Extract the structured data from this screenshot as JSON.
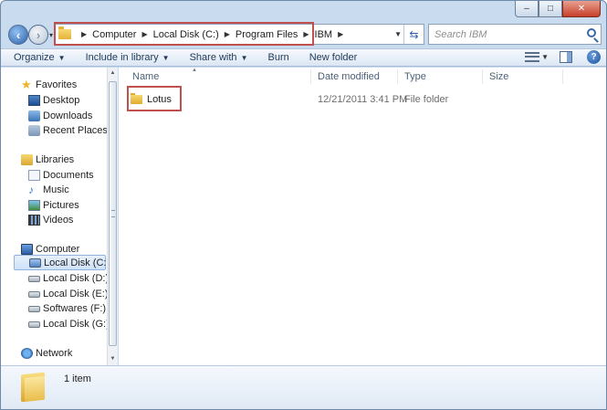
{
  "window": {
    "controls": {
      "minimize": "–",
      "maximize": "□",
      "close": "✕"
    }
  },
  "address": {
    "crumbs": [
      "Computer",
      "Local Disk (C:)",
      "Program Files",
      "IBM"
    ]
  },
  "search": {
    "placeholder": "Search IBM"
  },
  "toolbar": {
    "organize": "Organize",
    "include_in_library": "Include in library",
    "share_with": "Share with",
    "burn": "Burn",
    "new_folder": "New folder",
    "help": "?"
  },
  "nav": {
    "favorites": "Favorites",
    "desktop": "Desktop",
    "downloads": "Downloads",
    "recent_places": "Recent Places",
    "libraries": "Libraries",
    "documents": "Documents",
    "music": "Music",
    "pictures": "Pictures",
    "videos": "Videos",
    "computer": "Computer",
    "drives": [
      "Local Disk (C:)",
      "Local Disk (D:)",
      "Local Disk (E:)",
      "Softwares (F:)",
      "Local Disk (G:)"
    ],
    "network": "Network"
  },
  "columns": {
    "name": "Name",
    "date_modified": "Date modified",
    "type": "Type",
    "size": "Size"
  },
  "rows": [
    {
      "name": "Lotus",
      "date_modified": "12/21/2011 3:41 PM",
      "type": "File folder",
      "size": ""
    }
  ],
  "status": {
    "item_count": "1 item"
  }
}
